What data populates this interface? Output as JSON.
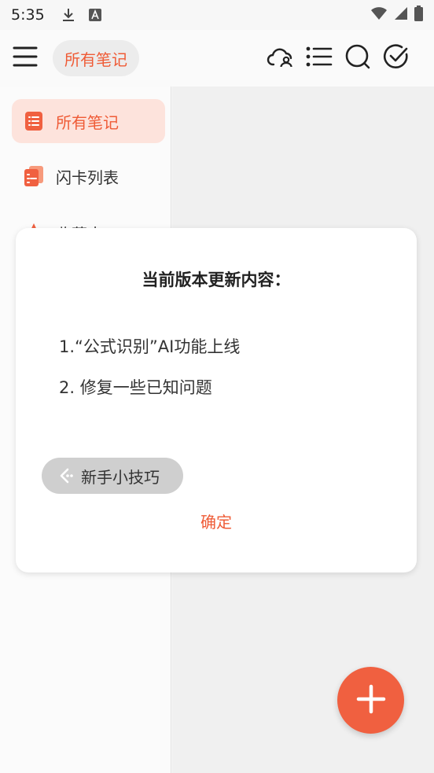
{
  "status_bar": {
    "time": "5:35"
  },
  "app_bar": {
    "title_chip": "所有笔记"
  },
  "sidebar": {
    "items": [
      {
        "label": "所有笔记",
        "active": true
      },
      {
        "label": "闪卡列表",
        "active": false
      },
      {
        "label": "收藏夹",
        "active": false
      }
    ]
  },
  "dialog": {
    "title": "当前版本更新内容：",
    "lines": [
      "1.“公式识别”AI功能上线",
      "2. 修复一些已知问题"
    ],
    "tips_label": "新手小技巧",
    "confirm_label": "确定"
  },
  "colors": {
    "accent": "#ef5b36",
    "active_bg": "#fde3dc",
    "fab": "#f06040"
  },
  "icons": {
    "status": [
      "download-icon",
      "text-a-icon",
      "wifi-icon",
      "signal-icon",
      "battery-icon"
    ],
    "app_bar": [
      "menu-icon",
      "cloud-user-icon",
      "list-icon",
      "search-icon",
      "check-circle-icon"
    ],
    "sidebar": [
      "notes-icon",
      "flashcard-icon",
      "star-icon"
    ],
    "dialog": [
      "tips-arrow-icon"
    ],
    "fab": "plus-icon"
  }
}
